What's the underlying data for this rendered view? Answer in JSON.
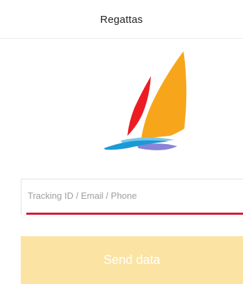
{
  "header": {
    "title": "Regattas"
  },
  "logo": {
    "icon": "sailboat-logo-icon",
    "colors": {
      "sail_red": "#ec1c24",
      "sail_orange": "#f7a61c",
      "wave_blue": "#1b9ad6",
      "wave_light_blue": "#7cc6ea",
      "wave_purple": "#8a84d6"
    }
  },
  "form": {
    "input": {
      "placeholder": "Tracking ID / Email / Phone",
      "value": "",
      "underline_color": "#d7172f"
    },
    "submit": {
      "label": "Send data",
      "background": "#fbe3a4"
    }
  }
}
